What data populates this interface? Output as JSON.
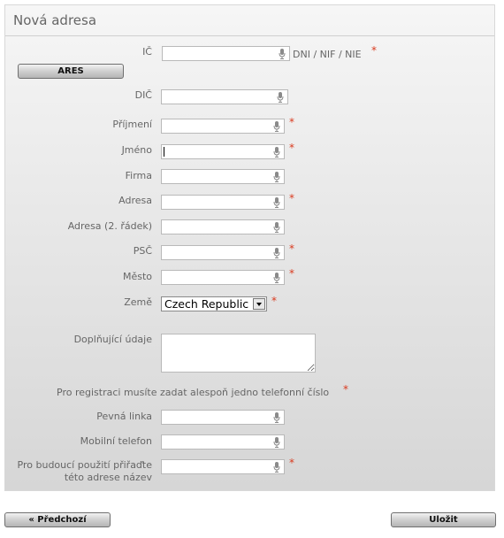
{
  "form": {
    "title": "Nová adresa",
    "ares_button": "ARES",
    "fields": {
      "ic": {
        "label": "IČ",
        "value": "",
        "hint": "DNI / NIF / NIE"
      },
      "dic": {
        "label": "DIČ",
        "value": ""
      },
      "prijmeni": {
        "label": "Příjmení",
        "value": ""
      },
      "jmeno": {
        "label": "Jméno",
        "value": ""
      },
      "firma": {
        "label": "Firma",
        "value": ""
      },
      "adresa": {
        "label": "Adresa",
        "value": ""
      },
      "adresa2": {
        "label": "Adresa (2. řádek)",
        "value": ""
      },
      "psc": {
        "label": "PSČ",
        "value": ""
      },
      "mesto": {
        "label": "Město",
        "value": ""
      },
      "zeme": {
        "label": "Země",
        "selected": "Czech Republic"
      },
      "doplnujici": {
        "label": "Doplňující údaje",
        "value": ""
      },
      "phone_note": "Pro registraci musíte zadat alespoň jedno telefonní číslo",
      "pevna": {
        "label": "Pevná linka",
        "value": ""
      },
      "mobil": {
        "label": "Mobilní telefon",
        "value": ""
      },
      "nazev": {
        "label_line1": "Pro budoucí použití přiřaďte",
        "label_line2": "této adrese název",
        "value": ""
      }
    },
    "required_mark": "*"
  },
  "footer": {
    "prev_button": "« Předchozí",
    "save_button": "Uložit"
  },
  "colors": {
    "required": "#d93a1e",
    "panel_top": "#f6f6f6",
    "panel_bottom": "#d6d6d6"
  },
  "icons": {
    "field_icon": "microphone-icon",
    "select_icon": "dropdown-arrow-icon"
  }
}
